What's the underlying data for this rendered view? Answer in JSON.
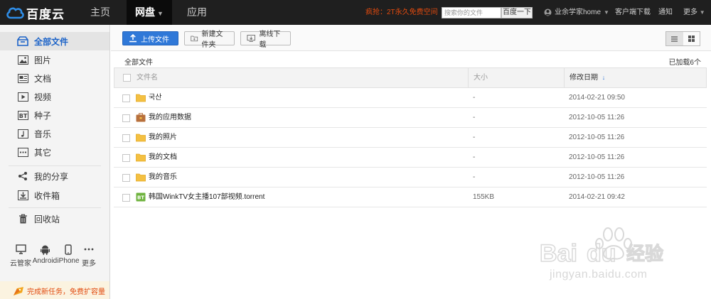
{
  "header": {
    "logo_text": "百度云",
    "nav": [
      {
        "label": "主页"
      },
      {
        "label": "网盘"
      },
      {
        "label": "应用"
      }
    ],
    "promo": "疯抢：2T永久免费空间",
    "search": {
      "placeholder": "搜索你的文件",
      "button": "百度一下"
    },
    "user": "业余学家home",
    "download_client": "客户端下载",
    "notice": "通知",
    "more": "更多"
  },
  "sidebar": {
    "items": [
      {
        "label": "全部文件",
        "icon": "folder-outline-icon"
      },
      {
        "label": "图片",
        "icon": "picture-icon"
      },
      {
        "label": "文档",
        "icon": "document-icon"
      },
      {
        "label": "视频",
        "icon": "video-icon"
      },
      {
        "label": "种子",
        "icon": "bt-icon"
      },
      {
        "label": "音乐",
        "icon": "music-icon"
      },
      {
        "label": "其它",
        "icon": "more-dots-icon"
      },
      {
        "label": "我的分享",
        "icon": "share-icon"
      },
      {
        "label": "收件箱",
        "icon": "inbox-icon"
      },
      {
        "label": "回收站",
        "icon": "trash-icon"
      }
    ],
    "devices": [
      {
        "label": "云管家",
        "icon": "desktop-icon"
      },
      {
        "label": "Android",
        "icon": "android-icon"
      },
      {
        "label": "iPhone",
        "icon": "iphone-icon"
      },
      {
        "label": "更多",
        "icon": "more-dots-icon"
      }
    ],
    "task_banner": "完成新任务，免费扩容量"
  },
  "toolbar": {
    "upload": "上传文件",
    "new_folder": "新建文件夹",
    "offline_download": "离线下载"
  },
  "breadcrumb": "全部文件",
  "loaded_count": "已加载6个",
  "table": {
    "columns": {
      "name": "文件名",
      "size": "大小",
      "date": "修改日期"
    },
    "rows": [
      {
        "name": "국산",
        "size": "-",
        "date": "2014-02-21  09:50",
        "type": "folder"
      },
      {
        "name": "我的应用数据",
        "size": "-",
        "date": "2012-10-05  11:26",
        "type": "app-folder"
      },
      {
        "name": "我的照片",
        "size": "-",
        "date": "2012-10-05  11:26",
        "type": "folder"
      },
      {
        "name": "我的文档",
        "size": "-",
        "date": "2012-10-05  11:26",
        "type": "folder"
      },
      {
        "name": "我的音乐",
        "size": "-",
        "date": "2012-10-05  11:26",
        "type": "folder"
      },
      {
        "name": "韩国WinkTV女主播107部视频.torrent",
        "size": "155KB",
        "date": "2014-02-21  09:42",
        "type": "torrent"
      }
    ]
  },
  "watermark": {
    "text": "jingyan.baidu.com"
  },
  "colors": {
    "accent": "#2f78d8",
    "topbar": "#1f1f1f",
    "promo": "#e14a0e",
    "folder": "#f4c042",
    "torrent": "#6fb33f"
  }
}
